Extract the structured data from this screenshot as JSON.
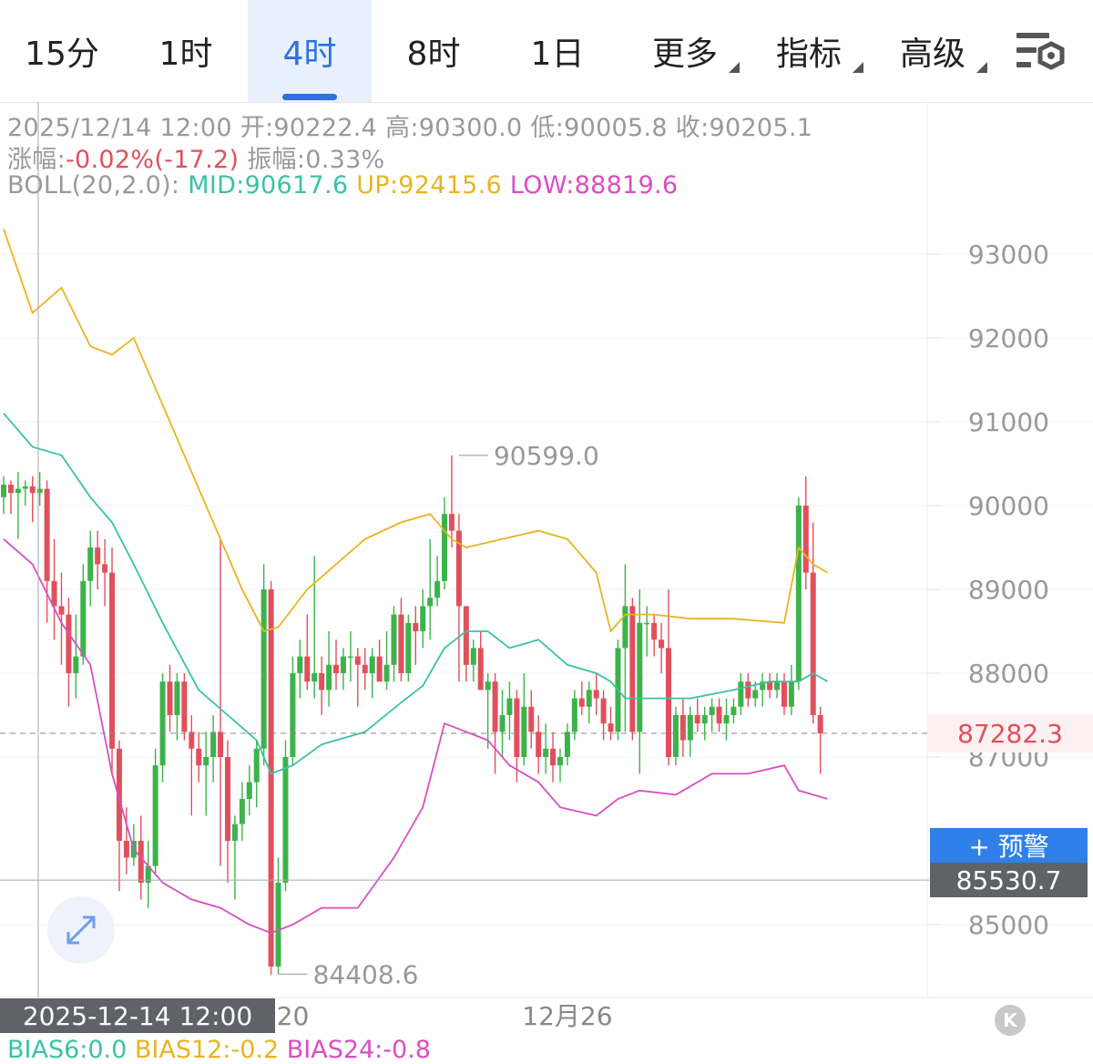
{
  "tabs": [
    {
      "label": "15分",
      "active": false,
      "dropdown": false
    },
    {
      "label": "1时",
      "active": false,
      "dropdown": false
    },
    {
      "label": "4时",
      "active": true,
      "dropdown": false
    },
    {
      "label": "8时",
      "active": false,
      "dropdown": false
    },
    {
      "label": "1日",
      "active": false,
      "dropdown": false
    },
    {
      "label": "更多",
      "active": false,
      "dropdown": true
    },
    {
      "label": "指标",
      "active": false,
      "dropdown": true
    },
    {
      "label": "高级",
      "active": false,
      "dropdown": true
    }
  ],
  "settings_icon": "chart-settings-icon",
  "info": {
    "date": "2025/12/14 12:00",
    "open_label": "开:",
    "open": "90222.4",
    "high_label": "高:",
    "high": "90300.0",
    "low_label": "低:",
    "low": "90005.8",
    "close_label": "收:",
    "close": "90205.1",
    "change_label": "涨幅:",
    "change": "-0.02%(-17.2)",
    "amp_label": "振幅:",
    "amp": "0.33%",
    "boll_label": "BOLL(20,2.0):",
    "boll_mid": "MID:90617.6",
    "boll_up": "UP:92415.6",
    "boll_low": "LOW:88819.6"
  },
  "current_price": "87282.3",
  "alert_button": "+ 预警",
  "crosshair_price": "85530.7",
  "crosshair_time": "2025-12-14 12:00",
  "bias": {
    "b6": "BIAS6:0.0",
    "b12": "BIAS12:-0.2",
    "b24": "BIAS24:-0.8"
  },
  "colors": {
    "up": "#3cb34a",
    "down": "#e0505c",
    "mid": "#3bc2a6",
    "upper": "#e9b421",
    "lower": "#d94ec2",
    "accent": "#2f6fe0"
  },
  "chart_data": {
    "type": "candlestick",
    "y_ticks": [
      93000,
      92000,
      91000,
      90000,
      89000,
      88000,
      87000,
      85000
    ],
    "ylim": [
      84000,
      93500
    ],
    "x_labels": [
      {
        "index": 36,
        "label": "12月20"
      },
      {
        "index": 78,
        "label": "12月26"
      }
    ],
    "annotations": [
      {
        "index": 62,
        "value": 90599.0,
        "label": "90599.0"
      },
      {
        "index": 37,
        "value": 84408.6,
        "label": "84408.6"
      }
    ],
    "candles": [
      {
        "o": 90100,
        "h": 90350,
        "l": 89900,
        "c": 90250
      },
      {
        "o": 90250,
        "h": 90300,
        "l": 89900,
        "c": 90150
      },
      {
        "o": 90150,
        "h": 90400,
        "l": 89600,
        "c": 90200
      },
      {
        "o": 90200,
        "h": 90300,
        "l": 90000,
        "c": 90230
      },
      {
        "o": 90230,
        "h": 90350,
        "l": 89800,
        "c": 90150
      },
      {
        "o": 90150,
        "h": 90400,
        "l": 90000,
        "c": 90200
      },
      {
        "o": 90200,
        "h": 90300,
        "l": 88600,
        "c": 89100
      },
      {
        "o": 89100,
        "h": 89600,
        "l": 88400,
        "c": 88800
      },
      {
        "o": 88800,
        "h": 89200,
        "l": 88100,
        "c": 88700
      },
      {
        "o": 88700,
        "h": 88900,
        "l": 87600,
        "c": 88000
      },
      {
        "o": 88000,
        "h": 88700,
        "l": 87700,
        "c": 88200
      },
      {
        "o": 88200,
        "h": 89300,
        "l": 88100,
        "c": 89100
      },
      {
        "o": 89100,
        "h": 89700,
        "l": 88800,
        "c": 89500
      },
      {
        "o": 89500,
        "h": 89700,
        "l": 89000,
        "c": 89300
      },
      {
        "o": 89300,
        "h": 89600,
        "l": 88800,
        "c": 89200
      },
      {
        "o": 89200,
        "h": 89500,
        "l": 86800,
        "c": 87100
      },
      {
        "o": 87100,
        "h": 87200,
        "l": 85400,
        "c": 86000
      },
      {
        "o": 86000,
        "h": 86400,
        "l": 85600,
        "c": 85800
      },
      {
        "o": 85800,
        "h": 86200,
        "l": 85700,
        "c": 86000
      },
      {
        "o": 86000,
        "h": 86300,
        "l": 85300,
        "c": 85500
      },
      {
        "o": 85500,
        "h": 86000,
        "l": 85200,
        "c": 85700
      },
      {
        "o": 85700,
        "h": 87100,
        "l": 85600,
        "c": 86900
      },
      {
        "o": 86900,
        "h": 88000,
        "l": 86700,
        "c": 87900
      },
      {
        "o": 87900,
        "h": 88100,
        "l": 87300,
        "c": 87500
      },
      {
        "o": 87500,
        "h": 88000,
        "l": 87200,
        "c": 87900
      },
      {
        "o": 87900,
        "h": 88000,
        "l": 87200,
        "c": 87300
      },
      {
        "o": 87300,
        "h": 87500,
        "l": 86300,
        "c": 87100
      },
      {
        "o": 87100,
        "h": 87300,
        "l": 86700,
        "c": 86900
      },
      {
        "o": 86900,
        "h": 87300,
        "l": 86300,
        "c": 87000
      },
      {
        "o": 87000,
        "h": 87500,
        "l": 86700,
        "c": 87300
      },
      {
        "o": 87300,
        "h": 89600,
        "l": 85700,
        "c": 87000
      },
      {
        "o": 87000,
        "h": 87200,
        "l": 85500,
        "c": 86000
      },
      {
        "o": 86000,
        "h": 86300,
        "l": 85300,
        "c": 86200
      },
      {
        "o": 86200,
        "h": 86700,
        "l": 86000,
        "c": 86500
      },
      {
        "o": 86500,
        "h": 86900,
        "l": 86300,
        "c": 86700
      },
      {
        "o": 86700,
        "h": 87200,
        "l": 86400,
        "c": 87100
      },
      {
        "o": 87100,
        "h": 89300,
        "l": 86900,
        "c": 89000
      },
      {
        "o": 89000,
        "h": 89100,
        "l": 84400,
        "c": 84500
      },
      {
        "o": 84500,
        "h": 85800,
        "l": 84408.6,
        "c": 85500
      },
      {
        "o": 85500,
        "h": 87200,
        "l": 85400,
        "c": 87000
      },
      {
        "o": 87000,
        "h": 88200,
        "l": 86900,
        "c": 88000
      },
      {
        "o": 88000,
        "h": 88400,
        "l": 87700,
        "c": 88200
      },
      {
        "o": 88200,
        "h": 88700,
        "l": 87800,
        "c": 87900
      },
      {
        "o": 87900,
        "h": 89400,
        "l": 87700,
        "c": 88000
      },
      {
        "o": 88000,
        "h": 88200,
        "l": 87500,
        "c": 87800
      },
      {
        "o": 87800,
        "h": 88500,
        "l": 87600,
        "c": 88100
      },
      {
        "o": 88100,
        "h": 88400,
        "l": 87800,
        "c": 88000
      },
      {
        "o": 88000,
        "h": 88300,
        "l": 87800,
        "c": 88200
      },
      {
        "o": 88200,
        "h": 88500,
        "l": 87900,
        "c": 88200
      },
      {
        "o": 88200,
        "h": 88300,
        "l": 87600,
        "c": 88100
      },
      {
        "o": 88100,
        "h": 88300,
        "l": 87800,
        "c": 88000
      },
      {
        "o": 88000,
        "h": 88300,
        "l": 87700,
        "c": 88200
      },
      {
        "o": 88200,
        "h": 88400,
        "l": 87900,
        "c": 87900
      },
      {
        "o": 87900,
        "h": 88500,
        "l": 87800,
        "c": 88100
      },
      {
        "o": 88100,
        "h": 88800,
        "l": 87900,
        "c": 88700
      },
      {
        "o": 88700,
        "h": 88900,
        "l": 87900,
        "c": 88000
      },
      {
        "o": 88000,
        "h": 88700,
        "l": 87900,
        "c": 88600
      },
      {
        "o": 88600,
        "h": 88800,
        "l": 88100,
        "c": 88500
      },
      {
        "o": 88500,
        "h": 89000,
        "l": 88300,
        "c": 88800
      },
      {
        "o": 88800,
        "h": 89600,
        "l": 88400,
        "c": 88900
      },
      {
        "o": 88900,
        "h": 89400,
        "l": 88800,
        "c": 89100
      },
      {
        "o": 89100,
        "h": 90100,
        "l": 89000,
        "c": 89900
      },
      {
        "o": 89900,
        "h": 90599,
        "l": 89500,
        "c": 89700
      },
      {
        "o": 89700,
        "h": 89900,
        "l": 87900,
        "c": 88800
      },
      {
        "o": 88800,
        "h": 88800,
        "l": 87900,
        "c": 88100
      },
      {
        "o": 88100,
        "h": 88400,
        "l": 87900,
        "c": 88300
      },
      {
        "o": 88300,
        "h": 88500,
        "l": 87800,
        "c": 87800
      },
      {
        "o": 87800,
        "h": 88000,
        "l": 87100,
        "c": 87900
      },
      {
        "o": 87900,
        "h": 88000,
        "l": 86800,
        "c": 87300
      },
      {
        "o": 87300,
        "h": 87800,
        "l": 87000,
        "c": 87500
      },
      {
        "o": 87500,
        "h": 87900,
        "l": 87200,
        "c": 87700
      },
      {
        "o": 87700,
        "h": 87800,
        "l": 86700,
        "c": 87000
      },
      {
        "o": 87000,
        "h": 88000,
        "l": 86900,
        "c": 87600
      },
      {
        "o": 87600,
        "h": 87800,
        "l": 87100,
        "c": 87300
      },
      {
        "o": 87300,
        "h": 87500,
        "l": 86800,
        "c": 87000
      },
      {
        "o": 87000,
        "h": 87400,
        "l": 86800,
        "c": 87100
      },
      {
        "o": 87100,
        "h": 87300,
        "l": 86700,
        "c": 86900
      },
      {
        "o": 86900,
        "h": 87100,
        "l": 86700,
        "c": 87000
      },
      {
        "o": 87000,
        "h": 87400,
        "l": 86900,
        "c": 87300
      },
      {
        "o": 87300,
        "h": 87800,
        "l": 87200,
        "c": 87700
      },
      {
        "o": 87700,
        "h": 87900,
        "l": 87500,
        "c": 87600
      },
      {
        "o": 87600,
        "h": 87900,
        "l": 87400,
        "c": 87800
      },
      {
        "o": 87800,
        "h": 88000,
        "l": 87500,
        "c": 87700
      },
      {
        "o": 87700,
        "h": 87800,
        "l": 87200,
        "c": 87400
      },
      {
        "o": 87400,
        "h": 87600,
        "l": 87200,
        "c": 87300
      },
      {
        "o": 87300,
        "h": 88400,
        "l": 87200,
        "c": 88300
      },
      {
        "o": 88300,
        "h": 89300,
        "l": 87300,
        "c": 88800
      },
      {
        "o": 88800,
        "h": 88900,
        "l": 87200,
        "c": 87300
      },
      {
        "o": 87300,
        "h": 89000,
        "l": 86800,
        "c": 88600
      },
      {
        "o": 88600,
        "h": 88800,
        "l": 88200,
        "c": 88600
      },
      {
        "o": 88600,
        "h": 88700,
        "l": 88200,
        "c": 88400
      },
      {
        "o": 88400,
        "h": 88600,
        "l": 88000,
        "c": 88300
      },
      {
        "o": 88300,
        "h": 89000,
        "l": 86900,
        "c": 87000
      },
      {
        "o": 87000,
        "h": 87600,
        "l": 86900,
        "c": 87500
      },
      {
        "o": 87500,
        "h": 87700,
        "l": 87000,
        "c": 87200
      },
      {
        "o": 87200,
        "h": 87600,
        "l": 87000,
        "c": 87500
      },
      {
        "o": 87500,
        "h": 87700,
        "l": 87300,
        "c": 87400
      },
      {
        "o": 87400,
        "h": 87600,
        "l": 87200,
        "c": 87500
      },
      {
        "o": 87500,
        "h": 87700,
        "l": 87300,
        "c": 87600
      },
      {
        "o": 87600,
        "h": 87700,
        "l": 87300,
        "c": 87400
      },
      {
        "o": 87400,
        "h": 87700,
        "l": 87200,
        "c": 87500
      },
      {
        "o": 87500,
        "h": 87700,
        "l": 87400,
        "c": 87600
      },
      {
        "o": 87600,
        "h": 88000,
        "l": 87500,
        "c": 87900
      },
      {
        "o": 87900,
        "h": 88000,
        "l": 87600,
        "c": 87700
      },
      {
        "o": 87700,
        "h": 87900,
        "l": 87600,
        "c": 87800
      },
      {
        "o": 87800,
        "h": 88000,
        "l": 87600,
        "c": 87900
      },
      {
        "o": 87900,
        "h": 88000,
        "l": 87700,
        "c": 87800
      },
      {
        "o": 87800,
        "h": 88000,
        "l": 87700,
        "c": 87900
      },
      {
        "o": 87900,
        "h": 88000,
        "l": 87500,
        "c": 87600
      },
      {
        "o": 87600,
        "h": 88100,
        "l": 87500,
        "c": 87900
      },
      {
        "o": 87900,
        "h": 90100,
        "l": 87800,
        "c": 90000
      },
      {
        "o": 90000,
        "h": 90350,
        "l": 89000,
        "c": 89200
      },
      {
        "o": 89200,
        "h": 89800,
        "l": 87400,
        "c": 87500
      },
      {
        "o": 87500,
        "h": 87600,
        "l": 86800,
        "c": 87282.3
      }
    ],
    "boll_up": [
      [
        0,
        93300
      ],
      [
        4,
        92300
      ],
      [
        8,
        92600
      ],
      [
        12,
        91900
      ],
      [
        15,
        91800
      ],
      [
        18,
        92000
      ],
      [
        22,
        91200
      ],
      [
        28,
        90000
      ],
      [
        33,
        89000
      ],
      [
        36,
        88500
      ],
      [
        38,
        88550
      ],
      [
        42,
        89000
      ],
      [
        46,
        89300
      ],
      [
        50,
        89600
      ],
      [
        55,
        89800
      ],
      [
        59,
        89900
      ],
      [
        62,
        89600
      ],
      [
        64,
        89500
      ],
      [
        69,
        89600
      ],
      [
        74,
        89700
      ],
      [
        78,
        89600
      ],
      [
        82,
        89200
      ],
      [
        84,
        88500
      ],
      [
        86,
        88700
      ],
      [
        90,
        88700
      ],
      [
        95,
        88650
      ],
      [
        101,
        88650
      ],
      [
        108,
        88600
      ],
      [
        110,
        89500
      ],
      [
        112,
        89300
      ],
      [
        114,
        89200
      ]
    ],
    "boll_mid": [
      [
        0,
        91100
      ],
      [
        4,
        90700
      ],
      [
        8,
        90600
      ],
      [
        12,
        90100
      ],
      [
        15,
        89800
      ],
      [
        18,
        89300
      ],
      [
        22,
        88600
      ],
      [
        27,
        87800
      ],
      [
        31,
        87500
      ],
      [
        35,
        87200
      ],
      [
        37,
        86800
      ],
      [
        40,
        86900
      ],
      [
        44,
        87150
      ],
      [
        50,
        87300
      ],
      [
        55,
        87650
      ],
      [
        58,
        87850
      ],
      [
        61,
        88300
      ],
      [
        64,
        88500
      ],
      [
        67,
        88500
      ],
      [
        70,
        88300
      ],
      [
        74,
        88400
      ],
      [
        78,
        88100
      ],
      [
        82,
        88000
      ],
      [
        84,
        87900
      ],
      [
        86,
        87700
      ],
      [
        90,
        87700
      ],
      [
        95,
        87700
      ],
      [
        101,
        87800
      ],
      [
        106,
        87900
      ],
      [
        110,
        87900
      ],
      [
        112,
        88000
      ],
      [
        114,
        87900
      ]
    ],
    "boll_low": [
      [
        0,
        89600
      ],
      [
        4,
        89300
      ],
      [
        8,
        88600
      ],
      [
        12,
        88100
      ],
      [
        15,
        86800
      ],
      [
        18,
        85900
      ],
      [
        22,
        85500
      ],
      [
        26,
        85300
      ],
      [
        30,
        85200
      ],
      [
        34,
        85000
      ],
      [
        37,
        84900
      ],
      [
        40,
        85000
      ],
      [
        44,
        85200
      ],
      [
        49,
        85200
      ],
      [
        54,
        85800
      ],
      [
        58,
        86400
      ],
      [
        61,
        87400
      ],
      [
        64,
        87300
      ],
      [
        67,
        87200
      ],
      [
        70,
        86900
      ],
      [
        74,
        86700
      ],
      [
        77,
        86400
      ],
      [
        82,
        86300
      ],
      [
        85,
        86500
      ],
      [
        88,
        86600
      ],
      [
        93,
        86550
      ],
      [
        98,
        86800
      ],
      [
        103,
        86800
      ],
      [
        108,
        86900
      ],
      [
        110,
        86600
      ],
      [
        114,
        86500
      ]
    ]
  }
}
